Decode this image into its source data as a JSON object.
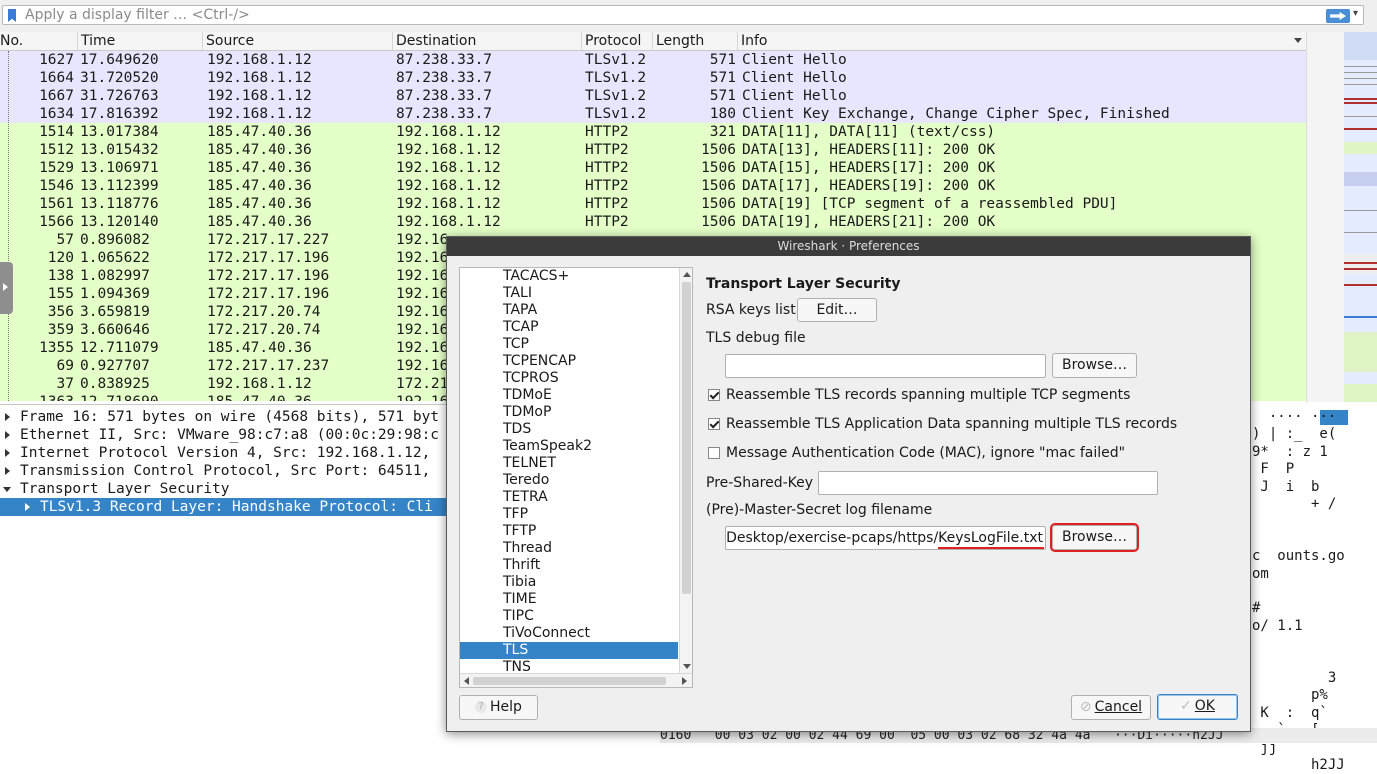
{
  "filter": {
    "placeholder": "Apply a display filter … <Ctrl-/>"
  },
  "columns": [
    "No.",
    "Time",
    "Source",
    "Destination",
    "Protocol",
    "Length",
    "Info"
  ],
  "packets": [
    {
      "no": "1627",
      "time": "17.649620",
      "src": "192.168.1.12",
      "dst": "87.238.33.7",
      "proto": "TLSv1.2",
      "len": "571",
      "info": "Client Hello",
      "bg": "#e7e6fe"
    },
    {
      "no": "1664",
      "time": "31.720520",
      "src": "192.168.1.12",
      "dst": "87.238.33.7",
      "proto": "TLSv1.2",
      "len": "571",
      "info": "Client Hello",
      "bg": "#e7e6fe"
    },
    {
      "no": "1667",
      "time": "31.726763",
      "src": "192.168.1.12",
      "dst": "87.238.33.7",
      "proto": "TLSv1.2",
      "len": "571",
      "info": "Client Hello",
      "bg": "#e7e6fe"
    },
    {
      "no": "1634",
      "time": "17.816392",
      "src": "192.168.1.12",
      "dst": "87.238.33.7",
      "proto": "TLSv1.2",
      "len": "180",
      "info": "Client Key Exchange, Change Cipher Spec, Finished",
      "bg": "#e7e6fe"
    },
    {
      "no": "1514",
      "time": "13.017384",
      "src": "185.47.40.36",
      "dst": "192.168.1.12",
      "proto": "HTTP2",
      "len": "321",
      "info": "DATA[11], DATA[11] (text/css)",
      "bg": "#e4ffc7"
    },
    {
      "no": "1512",
      "time": "13.015432",
      "src": "185.47.40.36",
      "dst": "192.168.1.12",
      "proto": "HTTP2",
      "len": "1506",
      "info": "DATA[13], HEADERS[11]: 200 OK",
      "bg": "#e4ffc7"
    },
    {
      "no": "1529",
      "time": "13.106971",
      "src": "185.47.40.36",
      "dst": "192.168.1.12",
      "proto": "HTTP2",
      "len": "1506",
      "info": "DATA[15], HEADERS[17]: 200 OK",
      "bg": "#e4ffc7"
    },
    {
      "no": "1546",
      "time": "13.112399",
      "src": "185.47.40.36",
      "dst": "192.168.1.12",
      "proto": "HTTP2",
      "len": "1506",
      "info": "DATA[17], HEADERS[19]: 200 OK",
      "bg": "#e4ffc7"
    },
    {
      "no": "1561",
      "time": "13.118776",
      "src": "185.47.40.36",
      "dst": "192.168.1.12",
      "proto": "HTTP2",
      "len": "1506",
      "info": "DATA[19] [TCP segment of a reassembled PDU]",
      "bg": "#e4ffc7"
    },
    {
      "no": "1566",
      "time": "13.120140",
      "src": "185.47.40.36",
      "dst": "192.168.1.12",
      "proto": "HTTP2",
      "len": "1506",
      "info": "DATA[19], HEADERS[21]: 200 OK",
      "bg": "#e4ffc7"
    },
    {
      "no": "57",
      "time": "0.896082",
      "src": "172.217.17.227",
      "dst": "192.16",
      "proto": "",
      "len": "",
      "info": "",
      "bg": "#e4ffc7"
    },
    {
      "no": "120",
      "time": "1.065622",
      "src": "172.217.17.196",
      "dst": "192.16",
      "proto": "",
      "len": "",
      "info": "",
      "bg": "#e4ffc7"
    },
    {
      "no": "138",
      "time": "1.082997",
      "src": "172.217.17.196",
      "dst": "192.16",
      "proto": "",
      "len": "",
      "info": "",
      "bg": "#e4ffc7"
    },
    {
      "no": "155",
      "time": "1.094369",
      "src": "172.217.17.196",
      "dst": "192.16",
      "proto": "",
      "len": "",
      "info": "",
      "bg": "#e4ffc7"
    },
    {
      "no": "356",
      "time": "3.659819",
      "src": "172.217.20.74",
      "dst": "192.16",
      "proto": "",
      "len": "",
      "info": "",
      "bg": "#e4ffc7"
    },
    {
      "no": "359",
      "time": "3.660646",
      "src": "172.217.20.74",
      "dst": "192.16",
      "proto": "",
      "len": "",
      "info": "",
      "bg": "#e4ffc7"
    },
    {
      "no": "1355",
      "time": "12.711079",
      "src": "185.47.40.36",
      "dst": "192.16",
      "proto": "",
      "len": "",
      "info": "",
      "bg": "#e4ffc7"
    },
    {
      "no": "69",
      "time": "0.927707",
      "src": "172.217.17.237",
      "dst": "192.16",
      "proto": "",
      "len": "",
      "info": "",
      "bg": "#e4ffc7"
    },
    {
      "no": "37",
      "time": "0.838925",
      "src": "192.168.1.12",
      "dst": "172.21",
      "proto": "",
      "len": "",
      "info": "",
      "bg": "#e4ffc7"
    },
    {
      "no": "1363",
      "time": "12.718690",
      "src": "185.47.40.36",
      "dst": "192.16",
      "proto": "",
      "len": "",
      "info": "",
      "bg": "#e4ffc7"
    }
  ],
  "details": [
    {
      "text": "Frame 16: 571 bytes on wire (4568 bits), 571 byt",
      "expanded": false,
      "selected": false,
      "indent": 0
    },
    {
      "text": "Ethernet II, Src: VMware_98:c7:a8 (00:0c:29:98:c",
      "expanded": false,
      "selected": false,
      "indent": 0
    },
    {
      "text": "Internet Protocol Version 4, Src: 192.168.1.12, ",
      "expanded": false,
      "selected": false,
      "indent": 0
    },
    {
      "text": "Transmission Control Protocol, Src Port: 64511, ",
      "expanded": false,
      "selected": false,
      "indent": 0
    },
    {
      "text": "Transport Layer Security",
      "expanded": true,
      "selected": false,
      "indent": 0
    },
    {
      "text": "TLSv1.3 Record Layer: Handshake Protocol: Cli",
      "expanded": false,
      "selected": true,
      "indent": 1
    }
  ],
  "bytes_ascii": [
    "  ···· ···",
    ") | :_  e(",
    "9*  : z 1",
    " F  P     ",
    " J  i  b  ",
    "       + /",
    "          ",
    "          ",
    "c  ounts.go",
    "om        ",
    "          ",
    "#         ",
    "o/ 1.1    ",
    "          ",
    "          ",
    "         3",
    "       p% ",
    " K  :  q` ",
    "   `   [. -",
    " jj       ",
    "       h2JJ"
  ],
  "bytes_bottom": "0160   00 03 02 00 02 44 69 00  05 00 03 02 68 32 4a 4a   ···Di·····h2JJ",
  "dialog": {
    "title": "Wireshark · Preferences",
    "protocols": [
      "TACACS+",
      "TALI",
      "TAPA",
      "TCAP",
      "TCP",
      "TCPENCAP",
      "TCPROS",
      "TDMoE",
      "TDMoP",
      "TDS",
      "TeamSpeak2",
      "TELNET",
      "Teredo",
      "TETRA",
      "TFP",
      "TFTP",
      "Thread",
      "Thrift",
      "Tibia",
      "TIME",
      "TIPC",
      "TiVoConnect",
      "TLS",
      "TNS"
    ],
    "selected_protocol": "TLS",
    "section_title": "Transport Layer Security",
    "rsa_keys_label": "RSA keys list",
    "edit_button": "Edit…",
    "debug_file_label": "TLS debug file",
    "debug_file_value": "",
    "browse_button": "Browse…",
    "checkbox_reassemble_tcp": {
      "label": "Reassemble TLS records spanning multiple TCP segments",
      "checked": true
    },
    "checkbox_reassemble_app": {
      "label": "Reassemble TLS Application Data spanning multiple TLS records",
      "checked": true
    },
    "checkbox_mac": {
      "label": "Message Authentication Code (MAC), ignore \"mac failed\"",
      "checked": false
    },
    "psk_label": "Pre-Shared-Key",
    "psk_value": "",
    "master_secret_label": "(Pre)-Master-Secret log filename",
    "master_secret_value": "/Desktop/exercise-pcaps/https/KeysLogFile.txt",
    "help_button": "Help",
    "cancel_button": "Cancel",
    "ok_button": "OK"
  },
  "colors": {
    "tls_row": "#e7e6fe",
    "http2_row": "#e4ffc7",
    "selection": "#3584c7",
    "highlight_red": "#e02020"
  }
}
